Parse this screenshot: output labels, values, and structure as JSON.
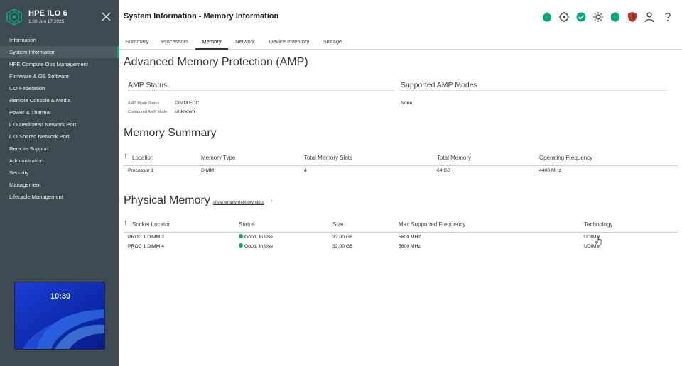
{
  "sidebar": {
    "app_title": "HPE iLO 6",
    "version": "1.69 Jun 17 2025",
    "items": [
      {
        "label": "Information"
      },
      {
        "label": "System Information"
      },
      {
        "label": "HPE Compute Ops Management"
      },
      {
        "label": "Firmware & OS Software"
      },
      {
        "label": "iLO Federation"
      },
      {
        "label": "Remote Console & Media"
      },
      {
        "label": "Power & Thermal"
      },
      {
        "label": "iLO Dedicated Network Port"
      },
      {
        "label": "iLO Shared Network Port"
      },
      {
        "label": "Remote Support"
      },
      {
        "label": "Administration"
      },
      {
        "label": "Security"
      },
      {
        "label": "Management"
      },
      {
        "label": "Lifecycle Management"
      }
    ],
    "active_index": 1,
    "console_thumbnail": {
      "clock": "10:39"
    }
  },
  "header": {
    "page_title": "System Information - Memory Information",
    "tabs": [
      {
        "label": "Summary"
      },
      {
        "label": "Processors"
      },
      {
        "label": "Memory"
      },
      {
        "label": "Network"
      },
      {
        "label": "Device Inventory"
      },
      {
        "label": "Storage"
      }
    ],
    "active_tab": "Memory",
    "icons": [
      "power-icon",
      "target-icon",
      "health-ok-icon",
      "indicator-light-icon",
      "hexagon-icon",
      "security-shield-icon",
      "user-icon",
      "help-icon"
    ]
  },
  "amp": {
    "title": "Advanced Memory Protection (AMP)",
    "status_heading": "AMP Status",
    "modes_heading": "Supported AMP Modes",
    "mode_status_label": "AMP Mode Status",
    "mode_status_value": "DIMM ECC",
    "configured_label": "Configured AMP Mode",
    "configured_value": "Unknown",
    "supported_modes_value": "None"
  },
  "memory_summary": {
    "title": "Memory Summary",
    "columns": [
      "Location",
      "Memory Type",
      "Total Memory Slots",
      "Total Memory",
      "Operating Frequency"
    ],
    "rows": [
      [
        "Processor 1",
        "DIMM",
        "4",
        "64 GB",
        "4400 MHz"
      ]
    ]
  },
  "physical_memory": {
    "title": "Physical Memory",
    "show_empty_link": "show empty memory slots",
    "columns": [
      "Socket Locator",
      "Status",
      "Size",
      "Max Supported Frequency",
      "Technology"
    ],
    "rows": [
      [
        "PROC 1 DIMM 2",
        "Good, In Use",
        "32.00 GB",
        "5600 MHz",
        "UDIMM"
      ],
      [
        "PROC 1 DIMM 4",
        "Good, In Use",
        "32.00 GB",
        "5600 MHz",
        "UDIMM"
      ]
    ]
  },
  "colors": {
    "sidebar_bg": "#3d4a52",
    "accent": "#01a982",
    "alert_red": "#c0392b"
  }
}
